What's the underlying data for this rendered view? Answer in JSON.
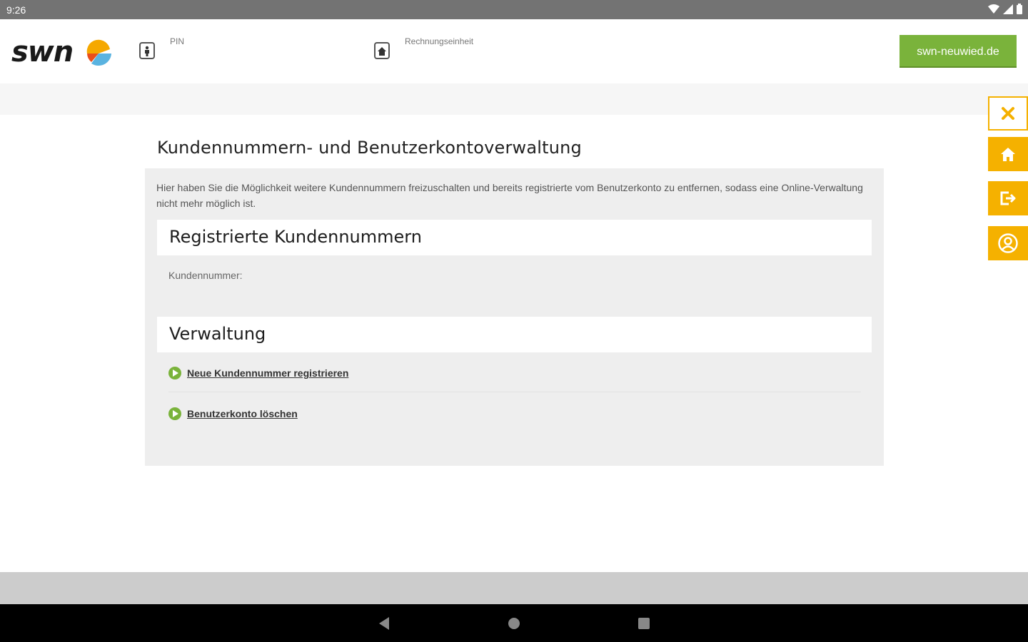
{
  "status_bar": {
    "time": "9:26",
    "icons": [
      "wifi-icon",
      "signal-icon",
      "battery-icon"
    ]
  },
  "header": {
    "logo_text": "swn",
    "pin_label": "PIN",
    "pin_icon": "person-icon",
    "billing_label": "Rechnungseinheit",
    "billing_icon": "home-icon",
    "site_button_label": "swn-neuwied.de"
  },
  "main": {
    "page_title": "Kundennummern- und Benutzerkontoverwaltung",
    "intro": "Hier haben Sie die Möglichkeit weitere Kundennummern freizuschalten und bereits registrierte vom Benutzerkonto zu entfernen, sodass eine Online-Verwaltung nicht mehr möglich ist.",
    "registered_section": {
      "title": "Registrierte Kundennummern",
      "customer_number_label": "Kundennummer:"
    },
    "management_section": {
      "title": "Verwaltung",
      "links": [
        {
          "label": "Neue Kundennummer registrieren",
          "icon": "arrow-right-icon"
        },
        {
          "label": "Benutzerkonto löschen",
          "icon": "arrow-right-icon"
        }
      ]
    }
  },
  "side_buttons": [
    "close-icon",
    "home-icon",
    "logout-icon",
    "user-icon"
  ],
  "nav_bar": [
    "back-icon",
    "home-circle-icon",
    "recents-icon"
  ],
  "colors": {
    "accent_green": "#7ab33b",
    "accent_orange": "#f5b100",
    "panel_bg": "#eeeeee"
  }
}
